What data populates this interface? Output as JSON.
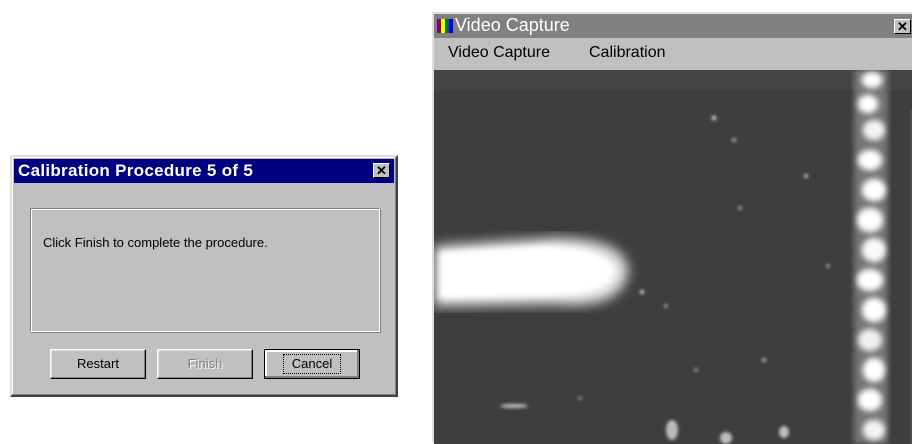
{
  "dialog": {
    "title": "Calibration Procedure 5 of 5",
    "close_glyph": "✕",
    "message": "Click Finish to complete the procedure.",
    "buttons": {
      "restart": "Restart",
      "finish": "Finish",
      "cancel": "Cancel"
    }
  },
  "video_window": {
    "title": "Video Capture",
    "close_glyph": "✕",
    "menu": [
      "Video Capture",
      "Calibration"
    ],
    "icon": "video-app-icon"
  },
  "colors": {
    "active_titlebar": "#000080",
    "inactive_titlebar": "#808080",
    "face": "#c0c0c0",
    "video_background": "#3e3e3e"
  }
}
